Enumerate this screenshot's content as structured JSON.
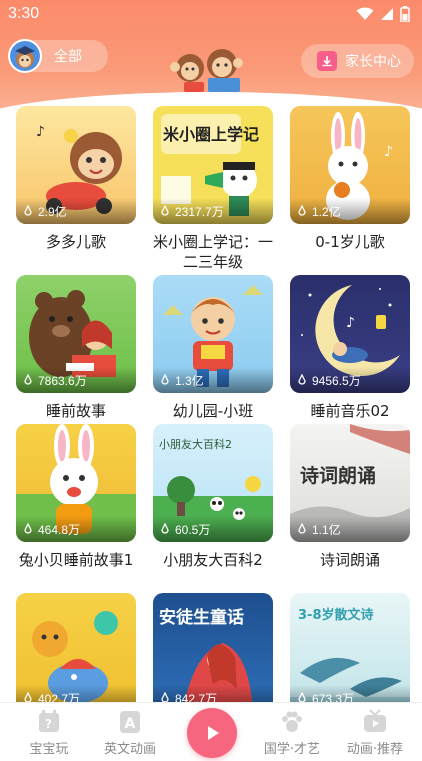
{
  "status_bar": {
    "time": "3:30"
  },
  "header": {
    "all_label": "全部",
    "parent_center_label": "家长中心"
  },
  "albums": [
    {
      "title": "多多儿歌",
      "plays": "2.9亿"
    },
    {
      "title": "米小圈上学记：一二三年级",
      "plays": "2317.7万"
    },
    {
      "title": "0-1岁儿歌",
      "plays": "1.2亿"
    },
    {
      "title": "睡前故事",
      "plays": "7863.6万"
    },
    {
      "title": "幼儿园-小班",
      "plays": "1.3亿"
    },
    {
      "title": "睡前音乐02",
      "plays": "9456.5万"
    },
    {
      "title": "兔小贝睡前故事1",
      "plays": "464.8万"
    },
    {
      "title": "小朋友大百科2",
      "plays": "60.5万"
    },
    {
      "title": "诗词朗诵",
      "plays": "1.1亿"
    },
    {
      "title": "",
      "plays": "402.7万"
    },
    {
      "title": "",
      "plays": "842.7万"
    },
    {
      "title": "",
      "plays": "673.3万"
    }
  ],
  "cover_text": {
    "album_2_cover": "米小圈上学记",
    "album_8_cover": "小朋友大百科2",
    "album_9_cover": "诗词朗诵",
    "album_11_cover": "安徒生童话",
    "album_12_cover": "3-8岁散文诗"
  },
  "bottom_nav": {
    "items": [
      {
        "label": "宝宝玩"
      },
      {
        "label": "英文动画"
      },
      {
        "label": "国学·才艺"
      },
      {
        "label": "动画·推荐"
      }
    ]
  },
  "colors": {
    "header_top": "#fb8a6a",
    "accent_pink": "#f7667f",
    "nav_text": "#8a8a8a"
  }
}
